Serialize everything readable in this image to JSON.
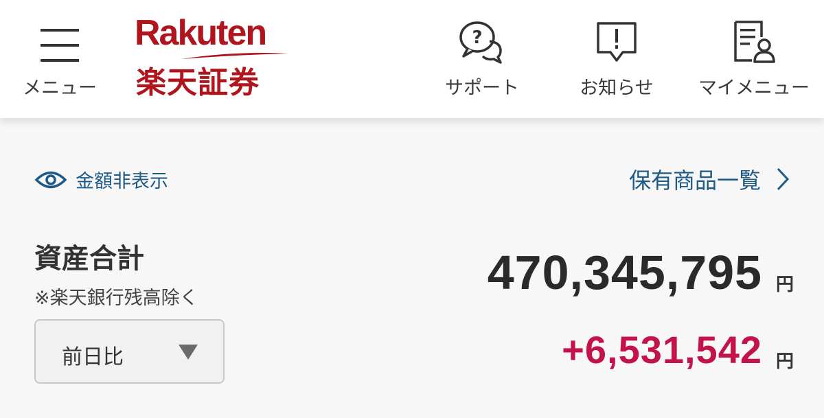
{
  "header": {
    "menu_label": "メニュー",
    "logo_en": "Rakuten",
    "logo_jp": "楽天証券",
    "support_label": "サポート",
    "notice_label": "お知らせ",
    "mymenu_label": "マイメニュー"
  },
  "main": {
    "hide_amount_label": "金額非表示",
    "holdings_link_label": "保有商品一覧",
    "asset_title": "資産合計",
    "asset_note": "※楽天銀行残高除く",
    "total_value": "470,345,795",
    "currency_unit": "円",
    "compare_selected": "前日比",
    "change_value": "+6,531,542"
  },
  "colors": {
    "brand_red": "#b0141c",
    "link_blue": "#1d5a86",
    "gain_red": "#c4124a"
  },
  "icons": [
    "hamburger-menu-icon",
    "support-chat-icon",
    "notice-alert-icon",
    "my-menu-document-icon",
    "eye-icon",
    "chevron-right-icon",
    "triangle-down-icon"
  ]
}
